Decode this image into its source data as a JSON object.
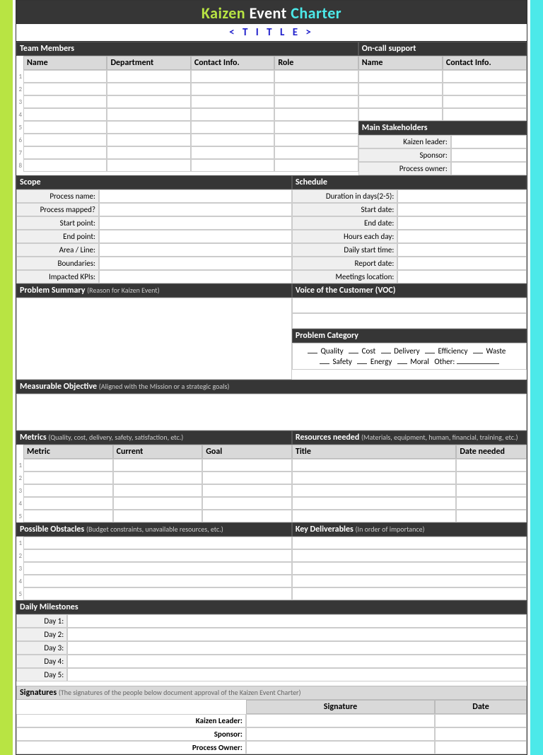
{
  "banner": {
    "w1": "Kaizen",
    "w2": "Event",
    "w3": "Charter"
  },
  "title": "< T I T L E >",
  "team": {
    "header": "Team Members",
    "cols": {
      "name": "Name",
      "dept": "Department",
      "contact": "Contact Info.",
      "role": "Role"
    },
    "rows": [
      "1",
      "2",
      "3",
      "4",
      "5",
      "6",
      "7",
      "8"
    ]
  },
  "oncall": {
    "header": "On-call support",
    "cols": {
      "name": "Name",
      "contact": "Contact Info."
    }
  },
  "stakeholders": {
    "header": "Main Stakeholders",
    "labels": {
      "leader": "Kaizen leader:",
      "sponsor": "Sponsor:",
      "owner": "Process owner:"
    }
  },
  "scope": {
    "header": "Scope",
    "labels": {
      "process": "Process name:",
      "mapped": "Process mapped?",
      "start": "Start point:",
      "end": "End point:",
      "area": "Area / Line:",
      "bound": "Boundaries:",
      "kpi": "Impacted KPIs:"
    }
  },
  "schedule": {
    "header": "Schedule",
    "labels": {
      "duration": "Duration in days(2-5):",
      "sdate": "Start date:",
      "edate": "End date:",
      "hours": "Hours each day:",
      "dstart": "Daily start time:",
      "report": "Report date:",
      "loc": "Meetings location:"
    }
  },
  "problem": {
    "header": "Problem Summary",
    "sub": "(Reason for Kaizen Event)"
  },
  "voc": {
    "header": "Voice of the Customer (VOC)"
  },
  "category": {
    "header": "Problem Category",
    "line1": [
      "Quality",
      "Cost",
      "Delivery",
      "Efficiency",
      "Waste"
    ],
    "line2": [
      "Safety",
      "Energy",
      "Moral"
    ],
    "other": "Other:"
  },
  "objective": {
    "header": "Measurable Objective",
    "sub": "(Aligned with the Mission or a strategic goals)"
  },
  "metrics": {
    "header": "Metrics",
    "sub": "(Quality, cost, delivery, safety, satisfaction, etc.)",
    "cols": {
      "metric": "Metric",
      "current": "Current",
      "goal": "Goal"
    },
    "rows": [
      "1",
      "2",
      "3",
      "4",
      "5"
    ]
  },
  "resources": {
    "header": "Resources needed",
    "sub": "(Materials, equipment, human, financial, training, etc.)",
    "cols": {
      "title": "Title",
      "date": "Date needed"
    }
  },
  "obstacles": {
    "header": "Possible Obstacles",
    "sub": "(Budget constraints, unavailable resources, etc.)",
    "rows": [
      "1",
      "2",
      "3",
      "4",
      "5"
    ]
  },
  "deliverables": {
    "header": "Key Deliverables",
    "sub": "(In order of importance)"
  },
  "milestones": {
    "header": "Daily Milestones",
    "labels": [
      "Day 1:",
      "Day 2:",
      "Day 3:",
      "Day 4:",
      "Day 5:"
    ]
  },
  "signatures": {
    "header": "Signatures",
    "sub": "(The signatures of the people below document approval of the Kaizen Event Charter)",
    "cols": {
      "sig": "Signature",
      "date": "Date"
    },
    "labels": {
      "leader": "Kaizen Leader:",
      "sponsor": "Sponsor:",
      "owner": "Process Owner:"
    }
  }
}
